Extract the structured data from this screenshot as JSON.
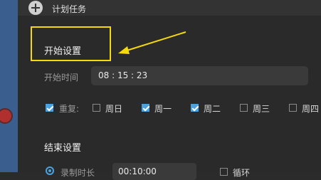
{
  "window": {
    "title": "计划任务",
    "icon": "add-circle-icon"
  },
  "start_section": {
    "title": "开始设置",
    "start_time_label": "开始时间",
    "start_time_value": "08 : 15 : 23"
  },
  "repeat": {
    "label": "重复:",
    "checked": true,
    "days": [
      {
        "label": "周日",
        "checked": false
      },
      {
        "label": "周一",
        "checked": true
      },
      {
        "label": "周二",
        "checked": true
      },
      {
        "label": "周三",
        "checked": false
      },
      {
        "label": "周四",
        "checked": false
      }
    ]
  },
  "end_section": {
    "title": "结束设置",
    "duration_label": "录制时长",
    "duration_value": "00:10:00",
    "loop_label": "循环"
  },
  "annotation": {
    "box_color": "#f5d90a",
    "arrow_color": "#f5d90a"
  },
  "colors": {
    "accent": "#4aa3df",
    "background": "#2a2a2a"
  }
}
